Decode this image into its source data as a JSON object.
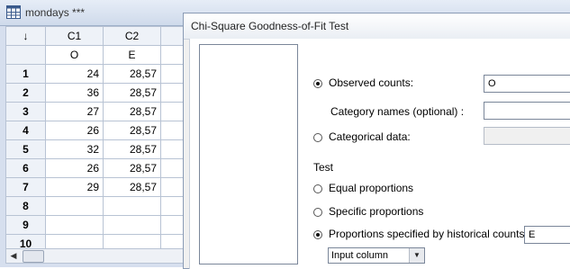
{
  "worksheet": {
    "title": "mondays ***",
    "corner_arrow": "↓",
    "columns": [
      {
        "id": "C1",
        "name": "O"
      },
      {
        "id": "C2",
        "name": "E"
      }
    ],
    "rows": [
      {
        "num": "1",
        "c1": "24",
        "c2": "28,57"
      },
      {
        "num": "2",
        "c1": "36",
        "c2": "28,57"
      },
      {
        "num": "3",
        "c1": "27",
        "c2": "28,57"
      },
      {
        "num": "4",
        "c1": "26",
        "c2": "28,57"
      },
      {
        "num": "5",
        "c1": "32",
        "c2": "28,57"
      },
      {
        "num": "6",
        "c1": "26",
        "c2": "28,57"
      },
      {
        "num": "7",
        "c1": "29",
        "c2": "28,57"
      },
      {
        "num": "8",
        "c1": "",
        "c2": ""
      },
      {
        "num": "9",
        "c1": "",
        "c2": ""
      },
      {
        "num": "10",
        "c1": "",
        "c2": ""
      }
    ]
  },
  "dialog": {
    "title": "Chi-Square Goodness-of-Fit Test",
    "observed_counts_label": "Observed counts:",
    "observed_counts_value": "O",
    "category_names_label": "Category names (optional) :",
    "category_names_value": "",
    "categorical_data_label": "Categorical data:",
    "categorical_data_value": "",
    "test_heading": "Test",
    "equal_proportions_label": "Equal proportions",
    "specific_proportions_label": "Specific proportions",
    "historical_label": "Proportions specified by historical counts:",
    "historical_value": "E",
    "input_type_selected": "Input column"
  },
  "colors": {
    "titlebar": "#d6dfee",
    "grid_border": "#b8c3d4",
    "dialog_bg": "#ffffff"
  }
}
